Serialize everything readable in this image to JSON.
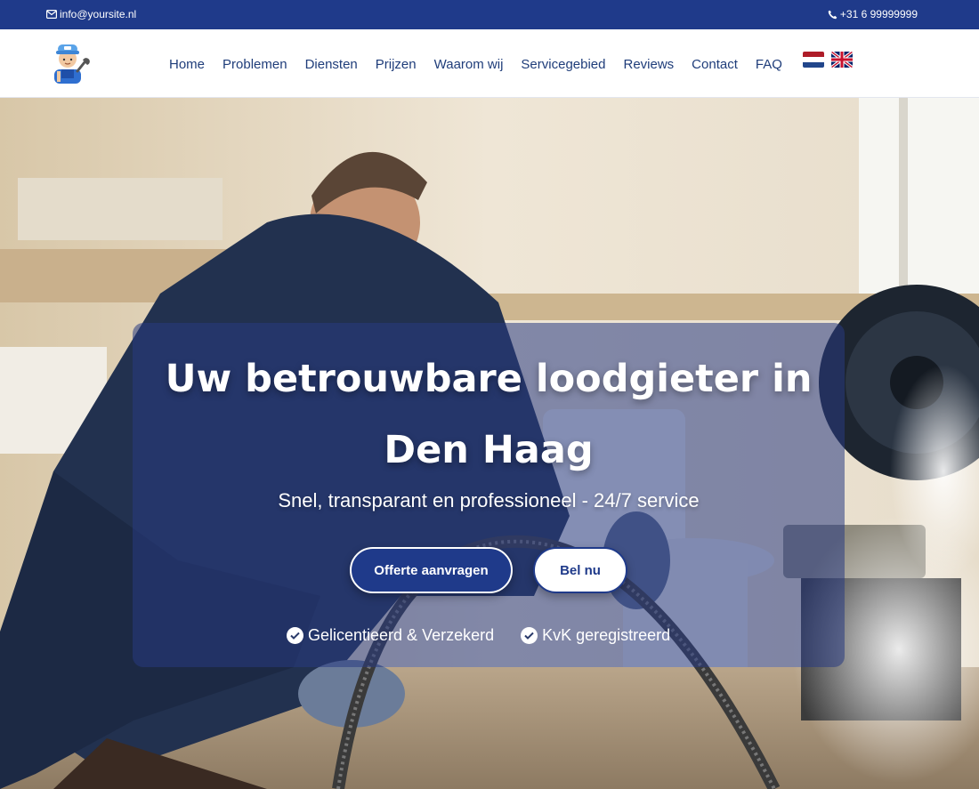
{
  "topbar": {
    "email": "info@yoursite.nl",
    "phone": "+31 6 99999999",
    "email_icon": "envelope-icon",
    "phone_icon": "phone-icon",
    "background": "#1f3a8a"
  },
  "brand": {
    "logo_icon": "plumber-mascot-logo"
  },
  "nav": {
    "items": [
      "Home",
      "Problemen",
      "Diensten",
      "Prijzen",
      "Waarom wij",
      "Servicegebied",
      "Reviews",
      "Contact",
      "FAQ"
    ],
    "languages": [
      {
        "code": "nl",
        "icon": "dutch-flag-icon"
      },
      {
        "code": "en",
        "icon": "uk-flag-icon"
      }
    ],
    "text_color": "#1f3d7a"
  },
  "hero": {
    "title": "Uw betrouwbare loodgieter in Den Haag",
    "subtitle": "Snel, transparant en professioneel - 24/7 service",
    "primary_button": "Offerte aanvragen",
    "secondary_button": "Bel nu",
    "badges": [
      "Gelicentieerd & Verzekerd",
      "KvK geregistreerd"
    ],
    "badge_icon": "check-circle-icon",
    "accent": "#1f3a8a"
  }
}
